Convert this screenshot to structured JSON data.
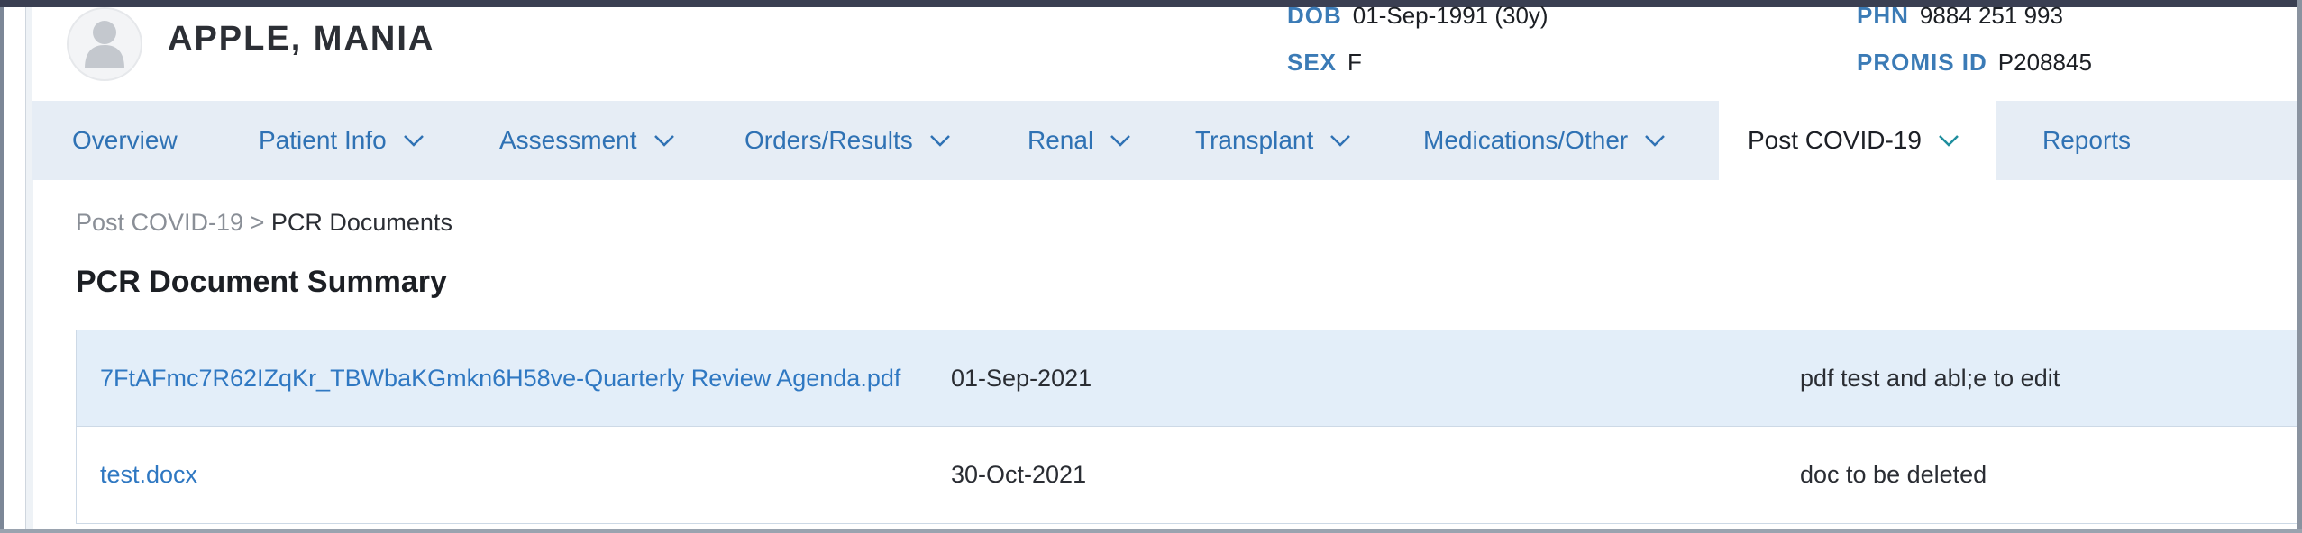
{
  "patient": {
    "name": "APPLE, MANIA",
    "dob_label": "DOB",
    "dob_value": "01-Sep-1991 (30y)",
    "sex_label": "SEX",
    "sex_value": "F",
    "phn_label": "PHN",
    "phn_value": "9884 251 993",
    "promis_label": "PROMIS ID",
    "promis_value": "P208845"
  },
  "nav": {
    "tabs": [
      {
        "label": "Overview",
        "has_menu": false
      },
      {
        "label": "Patient Info",
        "has_menu": true
      },
      {
        "label": "Assessment",
        "has_menu": true
      },
      {
        "label": "Orders/Results",
        "has_menu": true
      },
      {
        "label": "Renal",
        "has_menu": true
      },
      {
        "label": "Transplant",
        "has_menu": true
      },
      {
        "label": "Medications/Other",
        "has_menu": true
      },
      {
        "label": "Post COVID-19",
        "has_menu": true,
        "active": true
      },
      {
        "label": "Reports",
        "has_menu": false
      }
    ]
  },
  "breadcrumb": {
    "parent": "Post COVID-19",
    "separator": ">",
    "current": "PCR Documents"
  },
  "page": {
    "title": "PCR Document Summary"
  },
  "documents": [
    {
      "file": "7FtAFmc7R62IZqKr_TBWbaKGmkn6H58ve-Quarterly Review Agenda.pdf",
      "date": "01-Sep-2021",
      "description": "pdf test and abl;e to edit"
    },
    {
      "file": "test.docx",
      "date": "30-Oct-2021",
      "description": "doc to be deleted"
    }
  ],
  "colors": {
    "link": "#2f78c2",
    "tab_bar_bg": "#e6edf5",
    "selected_row_bg": "#e3eef9",
    "label_blue": "#3b7bb6"
  }
}
